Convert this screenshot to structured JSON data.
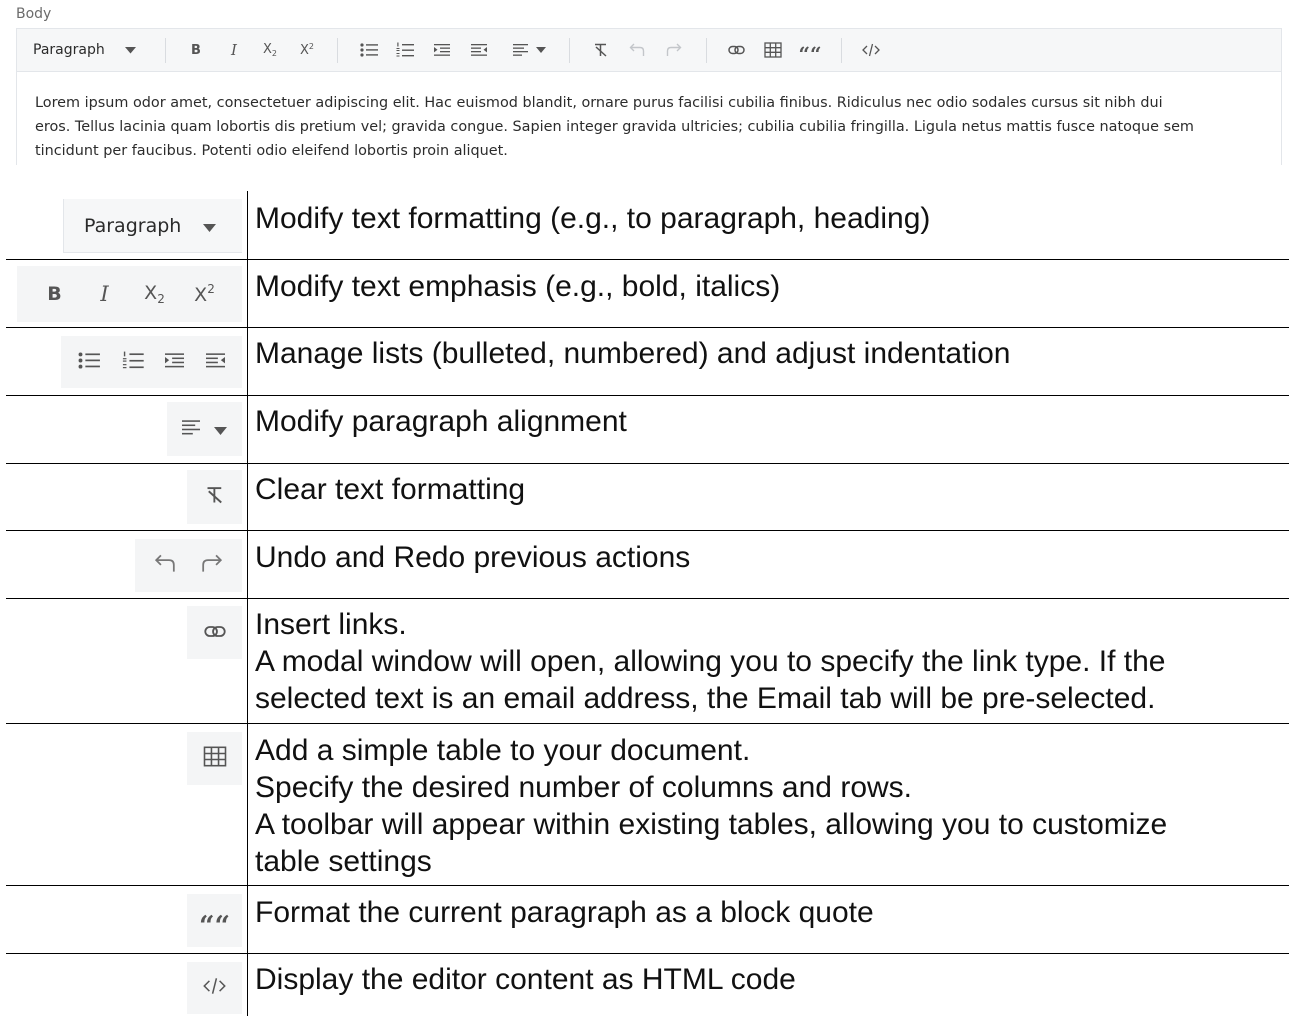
{
  "editor": {
    "label": "Body",
    "format_select": "Paragraph",
    "body_text": "Lorem ipsum odor amet, consectetuer adipiscing elit. Hac euismod blandit, ornare purus facilisi cubilia finibus. Ridiculus nec odio sodales cursus sit nibh dui eros. Tellus lacinia quam lobortis dis pretium vel; gravida congue. Sapien integer gravida ultricies; cubilia cubilia fringilla. Ligula netus mattis fusce natoque sem tincidunt per faucibus. Potenti odio eleifend lobortis proin aliquet.",
    "body_lines": [
      "Lorem ipsum odor amet, consectetuer adipiscing elit. Hac euismod blandit, ornare purus facilisi cubilia finibus. Ridiculus nec odio sodales cursus sit nibh dui",
      "eros. Tellus lacinia quam lobortis dis pretium vel; gravida congue. Sapien integer gravida ultricies; cubilia cubilia fringilla. Ligula netus mattis fusce natoque sem",
      "tincidunt per faucibus. Potenti odio eleifend lobortis proin aliquet."
    ],
    "toolbar": {
      "bold": "B",
      "italic": "I",
      "subscript": "X",
      "subscript_mark": "2",
      "superscript": "X",
      "superscript_mark": "2",
      "quote_glyph": "““"
    },
    "icons": [
      "caret-down-icon",
      "bulleted-list-icon",
      "numbered-list-icon",
      "indent-icon",
      "outdent-icon",
      "align-left-icon",
      "clear-format-icon",
      "undo-icon",
      "redo-icon",
      "link-icon",
      "table-icon",
      "blockquote-icon",
      "code-icon"
    ]
  },
  "guide": {
    "rows": [
      {
        "lines": [
          "Modify text formatting (e.g., to paragraph, heading)"
        ]
      },
      {
        "lines": [
          "Modify text emphasis (e.g., bold, italics)"
        ]
      },
      {
        "lines": [
          "Manage lists (bulleted, numbered) and adjust indentation"
        ]
      },
      {
        "lines": [
          "Modify paragraph alignment"
        ]
      },
      {
        "lines": [
          "Clear text formatting"
        ]
      },
      {
        "lines": [
          "Undo and Redo previous actions"
        ]
      },
      {
        "lines": [
          "Insert links.",
          "A modal window will open, allowing you to specify the link type. If the",
          "selected text is an email address, the Email tab will be pre-selected."
        ]
      },
      {
        "lines": [
          "Add a simple table to your document.",
          "Specify the desired number of columns and rows.",
          "A toolbar will appear within existing tables, allowing you to customize",
          "table settings"
        ]
      },
      {
        "lines": [
          "Format the current paragraph as a block quote"
        ]
      },
      {
        "lines": [
          "Display the editor content as HTML code"
        ]
      }
    ]
  },
  "colors": {
    "toolbar_bg": "#f6f7f8",
    "border": "#e3e6ea",
    "icon": "#555555",
    "icon_disabled": "#c3c6ca",
    "text": "#2c2c2c"
  }
}
